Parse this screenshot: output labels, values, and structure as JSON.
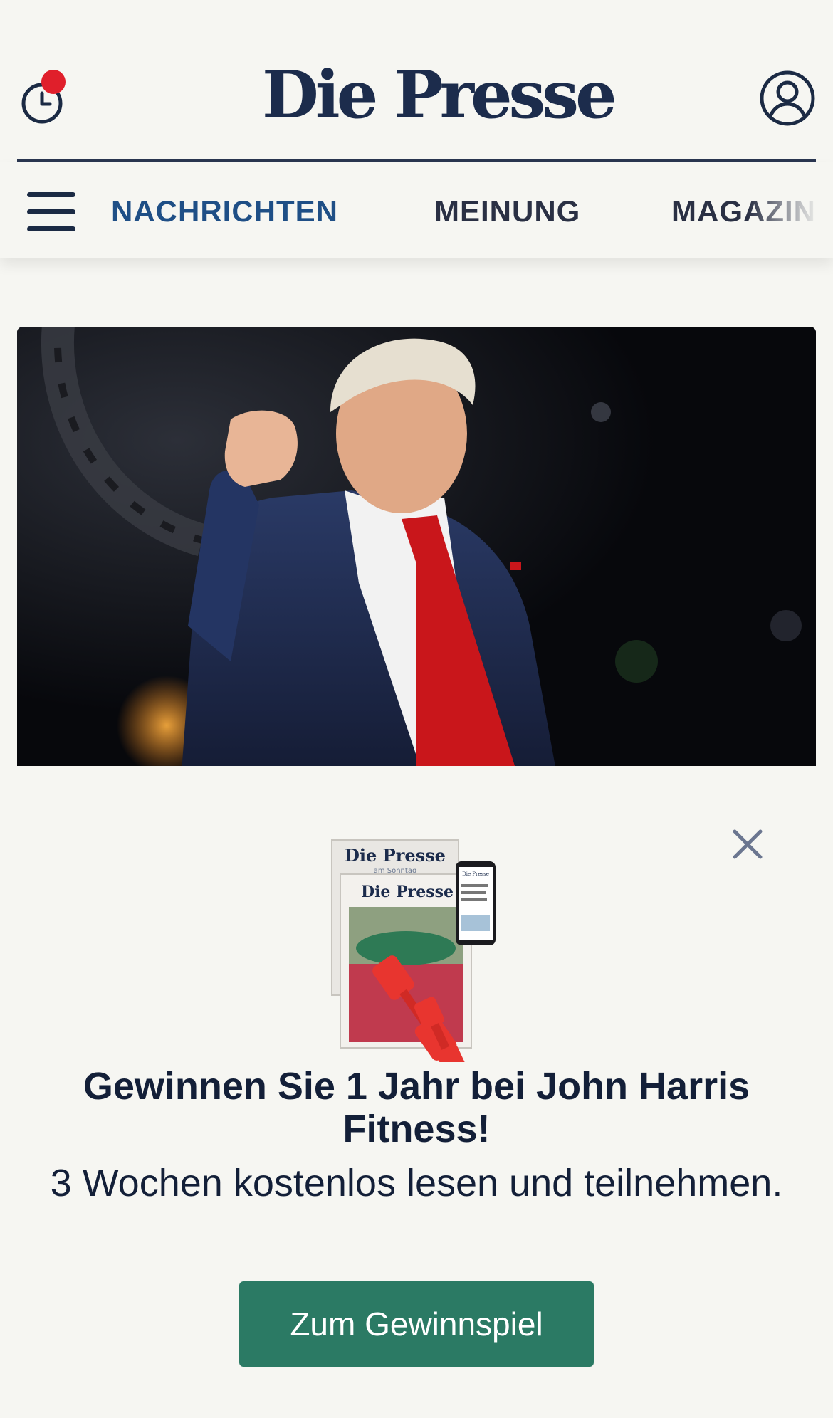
{
  "header": {
    "logo_text": "Die Presse",
    "history_icon": "history-clock-icon",
    "notification_dot_color": "#e01f2b",
    "user_icon": "user-account-icon"
  },
  "nav": {
    "menu_icon": "hamburger-menu-icon",
    "items": [
      {
        "label": "NACHRICHTEN",
        "active": true
      },
      {
        "label": "MEINUNG",
        "active": false
      },
      {
        "label": "MAGAZIN",
        "active": false
      }
    ],
    "active_color": "#1f4f86"
  },
  "hero": {
    "image": "news-photo"
  },
  "promo": {
    "close_icon": "close-icon",
    "graphic": {
      "paper_back_title": "Die Presse",
      "paper_back_subtitle": "am Sonntag",
      "paper_front_title": "Die Presse",
      "phone_title": "Die Presse"
    },
    "title": "Gewinnen Sie 1 Jahr bei John Harris Fitness!",
    "subtitle": "3 Wochen kostenlos lesen und teilnehmen.",
    "cta_label": "Zum Gewinnspiel",
    "cta_color": "#2b7a64"
  }
}
